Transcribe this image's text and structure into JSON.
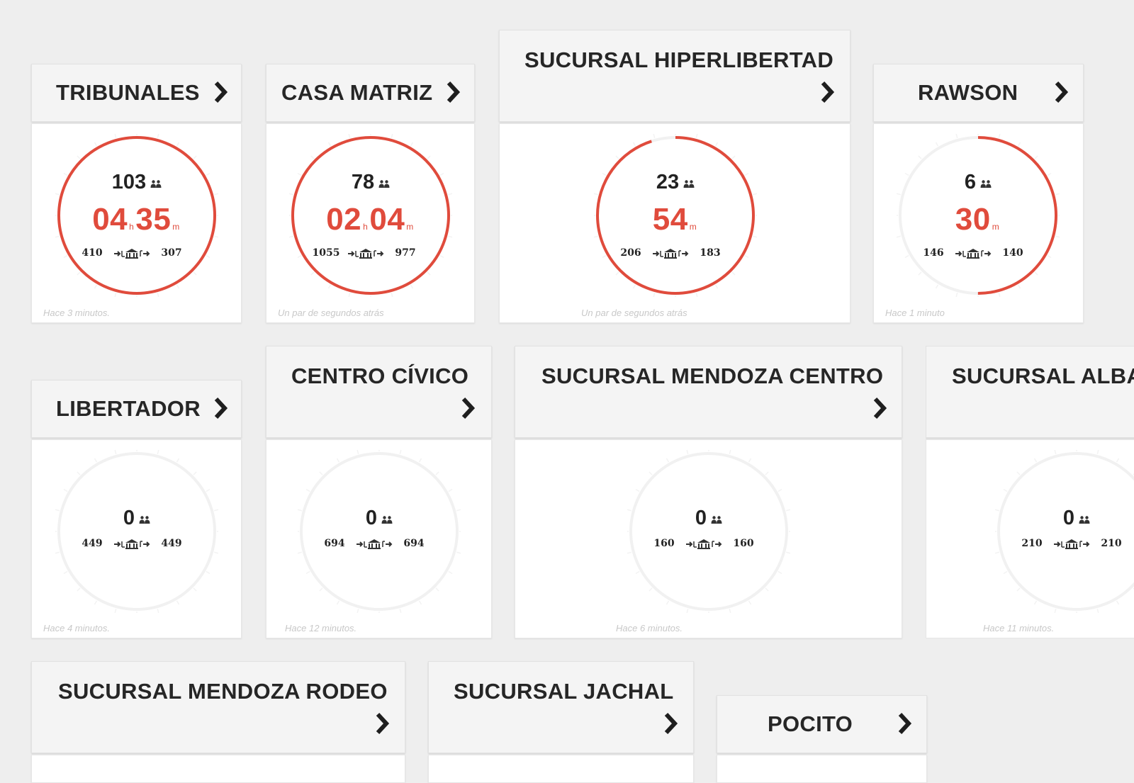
{
  "branches": [
    {
      "name": "TRIBUNALES",
      "people": "103",
      "wait_h": "04",
      "wait_m": "35",
      "entered": "410",
      "left": "307",
      "updated": "Hace 3 minutos.",
      "progress": 1.0
    },
    {
      "name": "CASA MATRIZ",
      "people": "78",
      "wait_h": "02",
      "wait_m": "04",
      "entered": "1055",
      "left": "977",
      "updated": "Un par de segundos atrás",
      "progress": 1.0
    },
    {
      "name": "SUCURSAL HIPERLIBERTAD",
      "people": "23",
      "wait_m": "54",
      "entered": "206",
      "left": "183",
      "updated": "Un par de segundos atrás",
      "progress": 0.95
    },
    {
      "name": "RAWSON",
      "people": "6",
      "wait_m": "30",
      "entered": "146",
      "left": "140",
      "updated": "Hace 1 minuto",
      "progress": 0.5
    },
    {
      "name": "LIBERTADOR",
      "people": "0",
      "entered": "449",
      "left": "449",
      "updated": "Hace 4 minutos.",
      "progress": 0
    },
    {
      "name": "CENTRO CÍVICO",
      "people": "0",
      "entered": "694",
      "left": "694",
      "updated": "Hace 12 minutos.",
      "progress": 0
    },
    {
      "name": "SUCURSAL MENDOZA CENTRO",
      "people": "0",
      "entered": "160",
      "left": "160",
      "updated": "Hace 6 minutos.",
      "progress": 0
    },
    {
      "name": "SUCURSAL ALBARDÓN",
      "people": "0",
      "entered": "210",
      "left": "210",
      "updated": "Hace 11 minutos.",
      "progress": 0
    },
    {
      "name": "SUCURSAL MENDOZA RODEO"
    },
    {
      "name": "SUCURSAL JACHAL"
    },
    {
      "name": "POCITO"
    }
  ],
  "units": {
    "hours": "h",
    "minutes": "m"
  },
  "icons": {
    "people": "people-icon",
    "flow": "bank-in-out-icon",
    "chevron": "chevron-right-icon"
  },
  "colors": {
    "accent": "#e04b3c",
    "track": "#f1f1f1",
    "background": "#eeeeee"
  }
}
